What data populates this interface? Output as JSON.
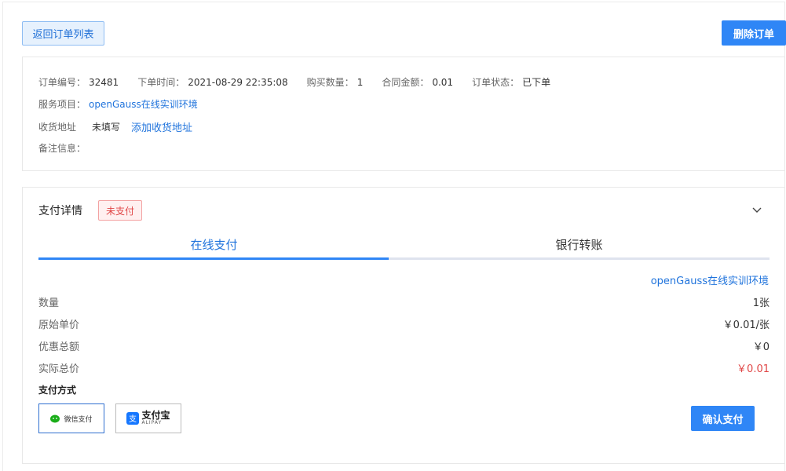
{
  "header": {
    "back_label": "返回订单列表",
    "delete_label": "删除订单"
  },
  "order": {
    "id_label": "订单编号：",
    "id_value": "32481",
    "time_label": "下单时间：",
    "time_value": "2021-08-29 22:35:08",
    "qty_label": "购买数量：",
    "qty_value": "1",
    "amount_label": "合同金额：",
    "amount_value": "0.01",
    "status_label": "订单状态：",
    "status_value": "已下单",
    "service_label": "服务项目：",
    "service_value": "openGauss在线实训环境",
    "address_label": "收货地址",
    "address_value": "未填写",
    "address_link": "添加收货地址",
    "remark_label": "备注信息："
  },
  "payment": {
    "title": "支付详情",
    "status_badge": "未支付",
    "tabs": [
      "在线支付",
      "银行转账"
    ],
    "service_name": "openGauss在线实训环境",
    "rows": [
      {
        "label": "数量",
        "value": "1张"
      },
      {
        "label": "原始单价",
        "value": "￥0.01/张"
      },
      {
        "label": "优惠总额",
        "value": "￥0"
      },
      {
        "label": "实际总价",
        "value": "￥0.01"
      }
    ],
    "method_label": "支付方式",
    "wechat_label": "微信支付",
    "alipay_label": "支付宝",
    "alipay_sub": "ALIPAY",
    "confirm_label": "确认支付",
    "colors": {
      "accent": "#2f86f6",
      "danger": "#e04646",
      "wechat": "#1aad19",
      "alipay": "#1677ff"
    }
  }
}
